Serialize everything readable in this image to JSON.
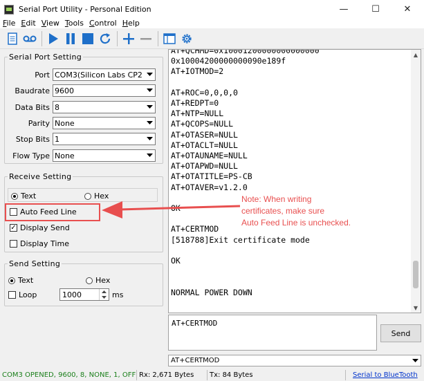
{
  "window": {
    "title": "Serial Port Utility - Personal Edition",
    "minimize": "—",
    "maximize": "☐",
    "close": "✕"
  },
  "menu": [
    {
      "label": "File",
      "mn": "F",
      "rest": "ile"
    },
    {
      "label": "Edit",
      "mn": "E",
      "rest": "dit"
    },
    {
      "label": "View",
      "mn": "V",
      "rest": "iew"
    },
    {
      "label": "Tools",
      "mn": "T",
      "rest": "ools"
    },
    {
      "label": "Control",
      "mn": "C",
      "rest": "ontrol"
    },
    {
      "label": "Help",
      "mn": "H",
      "rest": "elp"
    }
  ],
  "serial_port_setting": {
    "title": "Serial Port Setting",
    "port_label": "Port",
    "port_value": "COM3(Silicon Labs CP210x",
    "baudrate_label": "Baudrate",
    "baudrate_value": "9600",
    "databits_label": "Data Bits",
    "databits_value": "8",
    "parity_label": "Parity",
    "parity_value": "None",
    "stopbits_label": "Stop Bits",
    "stopbits_value": "1",
    "flowtype_label": "Flow Type",
    "flowtype_value": "None"
  },
  "receive_setting": {
    "title": "Receive Setting",
    "text_label": "Text",
    "hex_label": "Hex",
    "auto_feed_label": "Auto Feed Line",
    "display_send_label": "Display Send",
    "display_time_label": "Display Time",
    "display_send_checked": true,
    "auto_feed_checked": false,
    "display_time_checked": false
  },
  "send_setting": {
    "title": "Send Setting",
    "text_label": "Text",
    "hex_label": "Hex",
    "loop_label": "Loop",
    "loop_value": "1000",
    "loop_unit": "ms"
  },
  "output_text": "AT+QCHMD=0x10001200000000000000\n0x10004200000000090e189f\nAT+IOTMOD=2\n\nAT+ROC=0,0,0,0\nAT+REDPT=0\nAT+NTP=NULL\nAT+QCOPS=NULL\nAT+OTASER=NULL\nAT+OTACLT=NULL\nAT+OTAUNAME=NULL\nAT+OTAPWD=NULL\nAT+OTATITLE=PS-CB\nAT+OTAVER=v1.2.0\n\nOK\n\nAT+CERTMOD\n[518788]Exit certificate mode\n\nOK\n\n\nNORMAL POWER DOWN",
  "send_box_text": "AT+CERTMOD",
  "send_button": "Send",
  "history_value": "AT+CERTMOD",
  "status": {
    "connection": "COM3 OPENED, 9600, 8, NONE, 1, OFF",
    "rx": "Rx: 2,671 Bytes",
    "tx": "Tx: 84 Bytes",
    "link": "Serial to BlueTooth"
  },
  "annotation": {
    "line1": "Note: When writing",
    "line2": "certificates, make sure",
    "line3": "Auto Feed Line is unchecked."
  },
  "colors": {
    "annotation": "#e84f4f",
    "status_ok": "#1a7f1a",
    "toolbar_blue": "#1e6fc9"
  }
}
